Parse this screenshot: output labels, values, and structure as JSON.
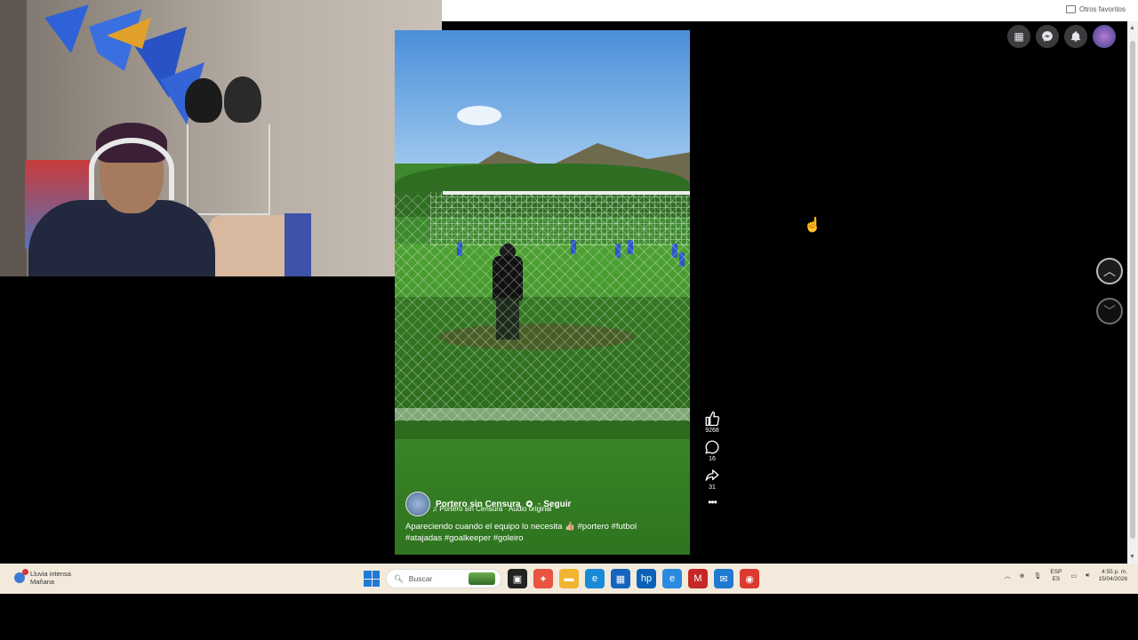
{
  "browser": {
    "favorites_label": "Otros favoritos"
  },
  "post": {
    "creator_name": "Portero sin Censura",
    "follow_label": "· Seguir",
    "audio_label": "♫ Portero sin Censura · Audio original",
    "caption": "Apareciendo cuando el equipo lo necesita 👍🏼 #portero  #futbol #atajadas #goalkeeper #goleiro",
    "likes": "9268",
    "comments": "16",
    "shares": "31",
    "more_label": "•••"
  },
  "taskbar": {
    "weather_line1": "Lluvia intensa",
    "weather_line2": "Mañana",
    "search_placeholder": "Buscar",
    "lang_line1": "ESP",
    "lang_line2": "ES",
    "time": "4:55 p. m.",
    "date": "15/04/2026"
  },
  "colors": {
    "accent": "#1e7ad8",
    "facebook_dark": "#3a3b3c",
    "taskbar_bg": "#f3eadc"
  },
  "icons": [
    "grid-icon",
    "messenger-icon",
    "bell-icon",
    "like-icon",
    "comment-icon",
    "share-icon",
    "chevron-up-icon",
    "chevron-down-icon",
    "windows-icon",
    "search-icon"
  ]
}
